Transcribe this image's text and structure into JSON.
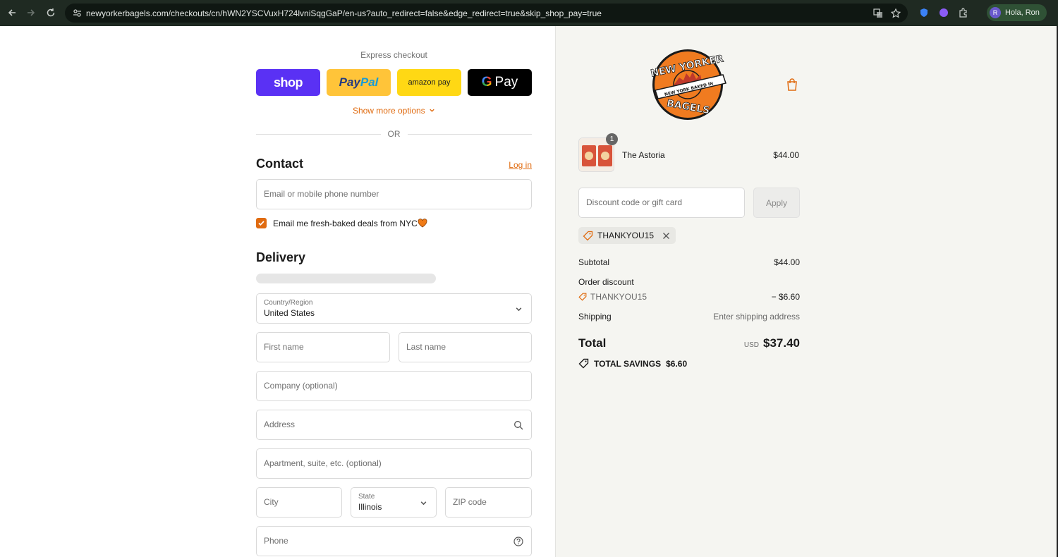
{
  "browser": {
    "url": "newyorkerbagels.com/checkouts/cn/hWN2YSCVuxH724lvniSqgGaP/en-us?auto_redirect=false&edge_redirect=true&skip_shop_pay=true",
    "profile_initial": "R",
    "profile_label": "Hola, Ron"
  },
  "express": {
    "label": "Express checkout",
    "shop_label": "shop",
    "paypal_pay": "Pay",
    "paypal_pal": "Pal",
    "amazon_label": "amazon pay",
    "gpay_g": "G",
    "gpay_label": "Pay",
    "show_more": "Show more options",
    "or_label": "OR"
  },
  "contact": {
    "title": "Contact",
    "login": "Log in",
    "email_placeholder": "Email or mobile phone number",
    "newsletter_label": "Email me fresh-baked deals from NYC",
    "newsletter_checked": true
  },
  "delivery": {
    "title": "Delivery",
    "country_label": "Country/Region",
    "country_value": "United States",
    "first_name": "First name",
    "last_name": "Last name",
    "company": "Company (optional)",
    "address": "Address",
    "apartment": "Apartment, suite, etc. (optional)",
    "city": "City",
    "state_label": "State",
    "state_value": "Illinois",
    "zip": "ZIP code",
    "phone": "Phone"
  },
  "summary": {
    "logo_text_top": "NEW YORKER",
    "logo_text_bottom": "BAGELS",
    "logo_ribbon": "NEW YORK BAKED IN",
    "product_name": "The Astoria",
    "product_qty": "1",
    "product_price": "$44.00",
    "discount_placeholder": "Discount code or gift card",
    "apply_label": "Apply",
    "applied_code": "THANKYOU15",
    "subtotal_label": "Subtotal",
    "subtotal_value": "$44.00",
    "order_discount_label": "Order discount",
    "discount_code": "THANKYOU15",
    "discount_value": "− $6.60",
    "shipping_label": "Shipping",
    "shipping_value": "Enter shipping address",
    "total_label": "Total",
    "currency": "USD",
    "total_value": "$37.40",
    "savings_label": "TOTAL SAVINGS",
    "savings_value": "$6.60"
  },
  "colors": {
    "accent": "#e06b10",
    "shop": "#5a31f4",
    "paypal": "#ffc439",
    "amazon": "#ffd814",
    "gpay": "#000000",
    "summary_bg": "#f5f5f1"
  }
}
